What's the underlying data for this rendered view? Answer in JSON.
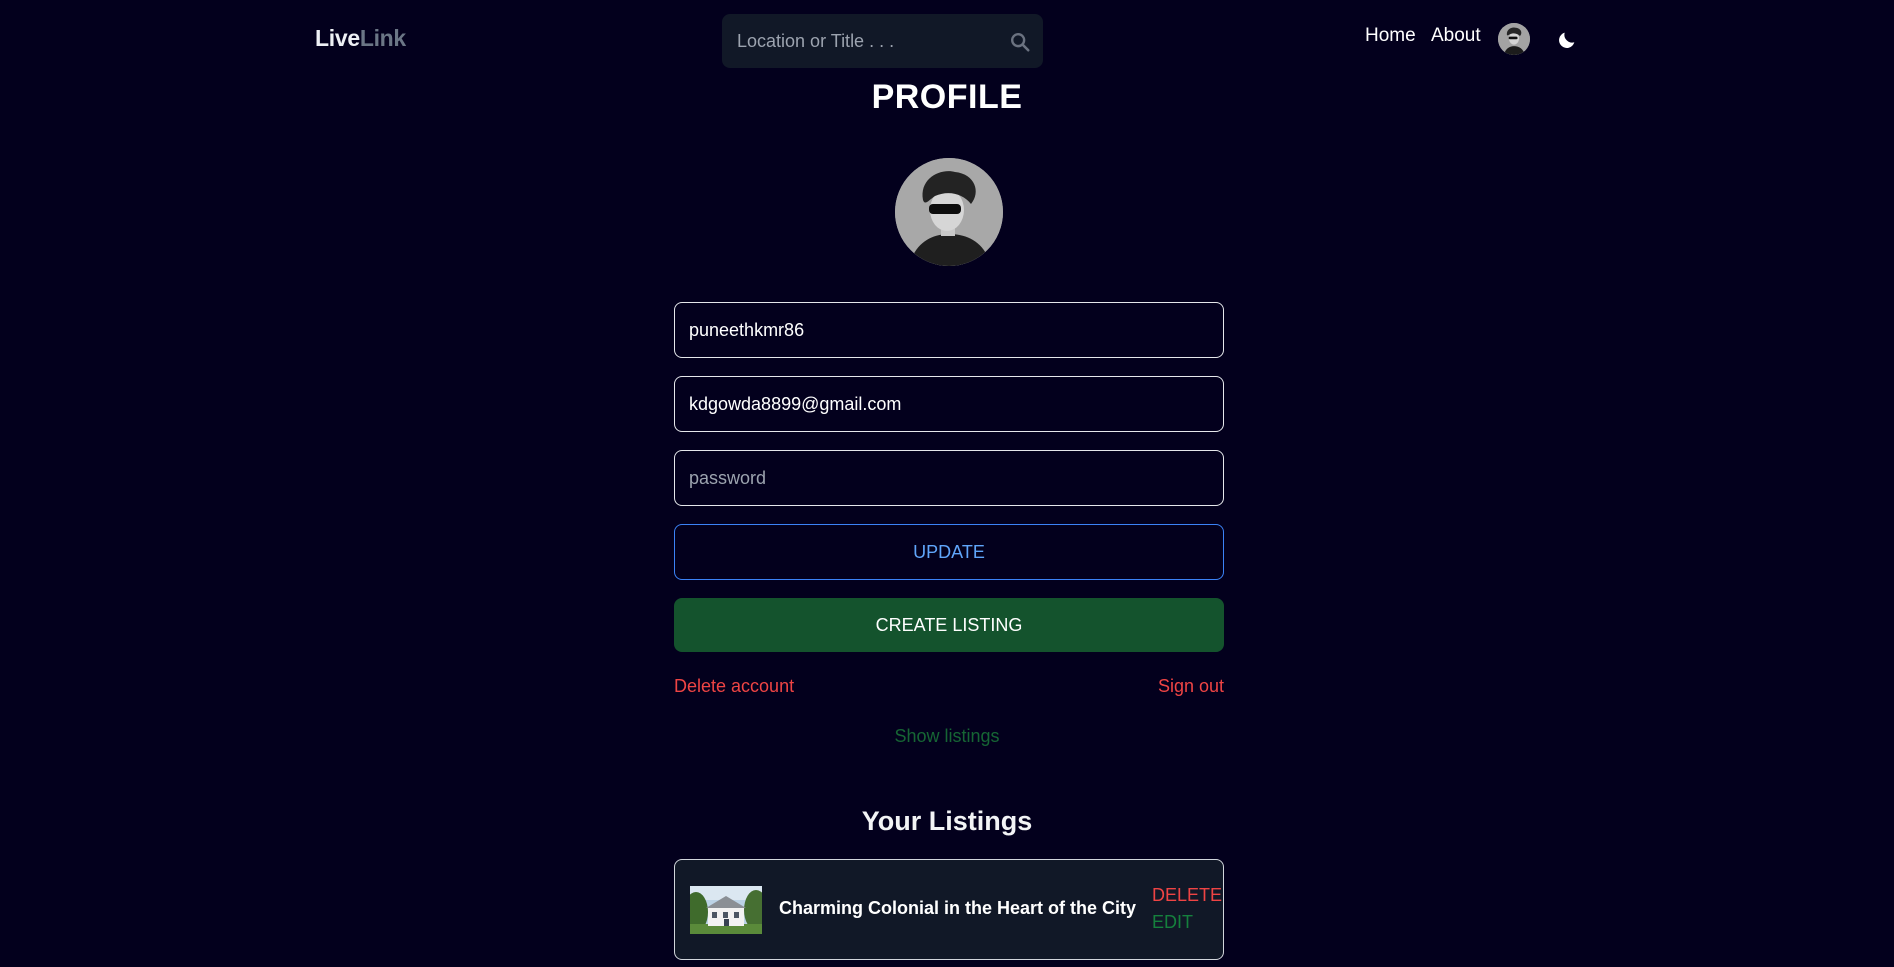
{
  "header": {
    "logo_part1": "Live",
    "logo_part2": "Link",
    "search_placeholder": "Location or Title . . .",
    "nav_home": "Home",
    "nav_about": "About",
    "search_icon": "search-icon",
    "theme_icon": "moon-icon"
  },
  "profile": {
    "title": "PROFILE",
    "username": "puneethkmr86",
    "email": "kdgowda8899@gmail.com",
    "password_placeholder": "password",
    "update_label": "UPDATE",
    "create_listing_label": "CREATE LISTING",
    "delete_account_label": "Delete account",
    "sign_out_label": "Sign out",
    "show_listings_label": "Show listings"
  },
  "listings": {
    "title": "Your Listings",
    "items": [
      {
        "name": "Charming Colonial in the Heart of the City",
        "delete_label": "DELETE",
        "edit_label": "EDIT"
      }
    ]
  },
  "colors": {
    "background": "#03001d",
    "update_accent": "#3b82f6",
    "create_listing": "#14532d",
    "danger": "#ef4444",
    "success_text": "#166534"
  }
}
